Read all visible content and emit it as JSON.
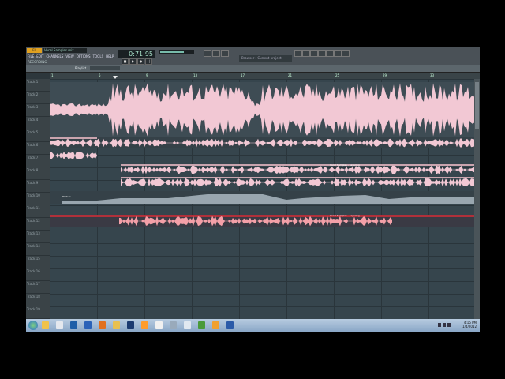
{
  "app": {
    "logo": "FL STUDIO",
    "song_name": "Vocal Samples mix",
    "menu": [
      "FILE",
      "EDIT",
      "CHANNELS",
      "VIEW",
      "OPTIONS",
      "TOOLS",
      "HELP"
    ],
    "hint_text": "RECORDING",
    "time_display": "0:71:95",
    "transport": [
      "■",
      "▶",
      "●",
      "||"
    ],
    "browser_path": "Browser › Current project"
  },
  "playlist": {
    "title": "Playlist",
    "tab_label": "Vocal Samples - Layering",
    "ruler_marks": [
      "1",
      "5",
      "9",
      "13",
      "17",
      "21",
      "25",
      "29",
      "33"
    ],
    "tracks": [
      "Track 1",
      "Track 2",
      "Track 3",
      "Track 4",
      "Track 5",
      "Track 6",
      "Track 7",
      "Track 8",
      "Track 9",
      "Track 10",
      "Track 11",
      "Track 12",
      "Track 13",
      "Track 14",
      "Track 15",
      "Track 16",
      "Track 17",
      "Track 18",
      "Track 19",
      "Track 20"
    ],
    "clip_labels": {
      "vocal_dup_1": "Vocal Samples - Layering",
      "automation": "Pattern",
      "vocal_dup_2": "Vocal Samples - Layering"
    }
  },
  "colors": {
    "waveform": "#f2c8d4",
    "selected_clip": "#f4a0a8",
    "selected_track_bar": "#b0303a",
    "automation": "#aab8c2"
  },
  "taskbar": {
    "time": "4:15 PM",
    "date": "1/4/2012",
    "icons": [
      "start-orb-icon",
      "explorer-icon",
      "media-player-icon",
      "word-icon",
      "firefox-icon",
      "folder-icon",
      "photoshop-icon",
      "winamp-icon",
      "email-icon",
      "calculator-icon",
      "paint-icon",
      "chrome-icon",
      "fl-studio-icon",
      "word-doc-icon",
      "app-icon"
    ]
  }
}
